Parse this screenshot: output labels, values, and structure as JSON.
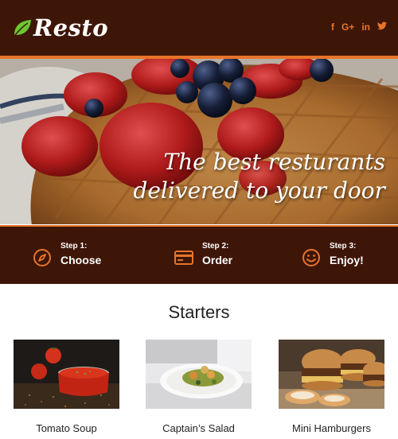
{
  "header": {
    "brand": "Resto",
    "social": [
      "f",
      "G+",
      "in",
      "t"
    ]
  },
  "hero": {
    "tagline_line1": "The best resturants",
    "tagline_line2": "delivered to your door"
  },
  "steps": [
    {
      "label": "Step 1:",
      "value": "Choose",
      "icon": "compass-icon"
    },
    {
      "label": "Step 2:",
      "value": "Order",
      "icon": "credit-card-icon"
    },
    {
      "label": "Step 3:",
      "value": "Enjoy!",
      "icon": "smiley-icon"
    }
  ],
  "starters": {
    "title": "Starters",
    "items": [
      {
        "name": "Tomato Soup"
      },
      {
        "name": "Captain’s Salad"
      },
      {
        "name": "Mini Hamburgers"
      }
    ]
  },
  "colors": {
    "header_bg": "#3e1607",
    "accent": "#e8742a",
    "logo_leaf": "#6cc832"
  }
}
